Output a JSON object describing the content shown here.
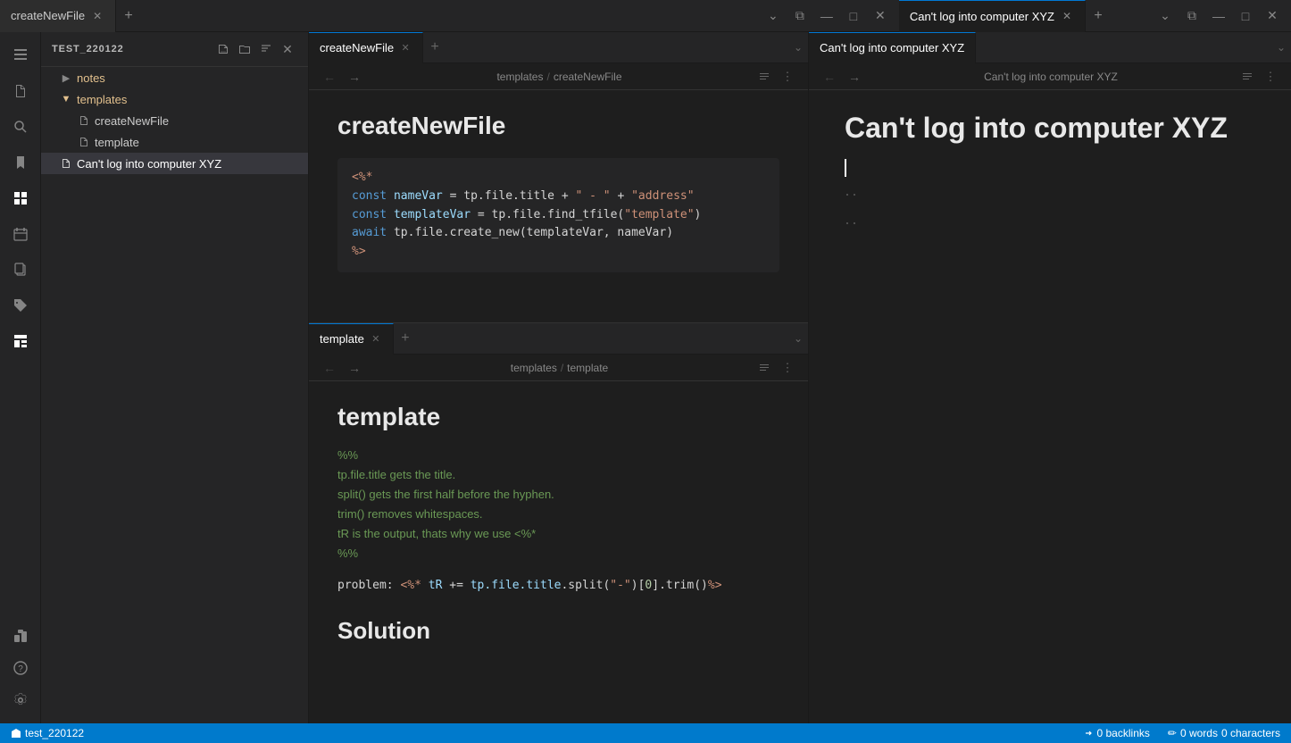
{
  "appTabs": [
    {
      "label": "createNewFile",
      "active": false,
      "closable": true
    },
    {
      "label": "Can't log into computer XYZ",
      "active": true,
      "closable": true
    }
  ],
  "sidebar": {
    "title": "test_220122",
    "tree": [
      {
        "level": 0,
        "type": "folder",
        "label": "notes",
        "expanded": false
      },
      {
        "level": 0,
        "type": "folder",
        "label": "templates",
        "expanded": true
      },
      {
        "level": 1,
        "type": "file",
        "label": "createNewFile"
      },
      {
        "level": 1,
        "type": "file",
        "label": "template"
      },
      {
        "level": 0,
        "type": "file",
        "label": "Can't log into computer XYZ",
        "active": true
      }
    ]
  },
  "leftPane": {
    "topEditor": {
      "tab": "createNewFile",
      "breadcrumb": {
        "folder": "templates",
        "file": "createNewFile"
      },
      "title": "createNewFile",
      "codeLines": [
        {
          "text": "<%*",
          "class": "code-tag"
        },
        {
          "parts": [
            {
              "text": "const ",
              "class": "code-keyword"
            },
            {
              "text": "nameVar",
              "class": "code-var"
            },
            {
              "text": " = tp.file.title + ",
              "class": "code-plain"
            },
            {
              "text": "\" - \"",
              "class": "code-string"
            },
            {
              "text": " + ",
              "class": "code-plain"
            },
            {
              "text": "\"address\"",
              "class": "code-string"
            }
          ]
        },
        {
          "parts": [
            {
              "text": "const ",
              "class": "code-keyword"
            },
            {
              "text": "templateVar",
              "class": "code-var"
            },
            {
              "text": " = tp.file.find_tfile(",
              "class": "code-plain"
            },
            {
              "text": "\"template\"",
              "class": "code-string"
            },
            {
              "text": ")",
              "class": "code-plain"
            }
          ]
        },
        {
          "parts": [
            {
              "text": "await",
              "class": "code-keyword"
            },
            {
              "text": " tp.file.create_new(templateVar, nameVar)",
              "class": "code-plain"
            }
          ]
        },
        {
          "text": "%>",
          "class": "code-tag"
        }
      ]
    },
    "bottomEditor": {
      "tab": "template",
      "breadcrumb": {
        "folder": "templates",
        "file": "template"
      },
      "title": "template",
      "commentLines": [
        "%%",
        "tp.file.title gets the title.",
        "split() gets the first half before the hyphen.",
        "trim() removes whitespaces.",
        "tR is the output, thats why we use <%*",
        "%%"
      ],
      "codeLine": {
        "prefix": "problem: ",
        "code": "<%* tR += tp.file.title.split(\"-\")[0].trim()%>"
      },
      "solutionLabel": "Solution"
    }
  },
  "rightPane": {
    "tab": "Can't log into computer XYZ",
    "title": "Can't log into computer XYZ",
    "dots": "·· ··"
  },
  "statusBar": {
    "backlinks": "0 backlinks",
    "wordCount": "0 words",
    "charCount": "0 characters",
    "editIcon": "✏"
  }
}
